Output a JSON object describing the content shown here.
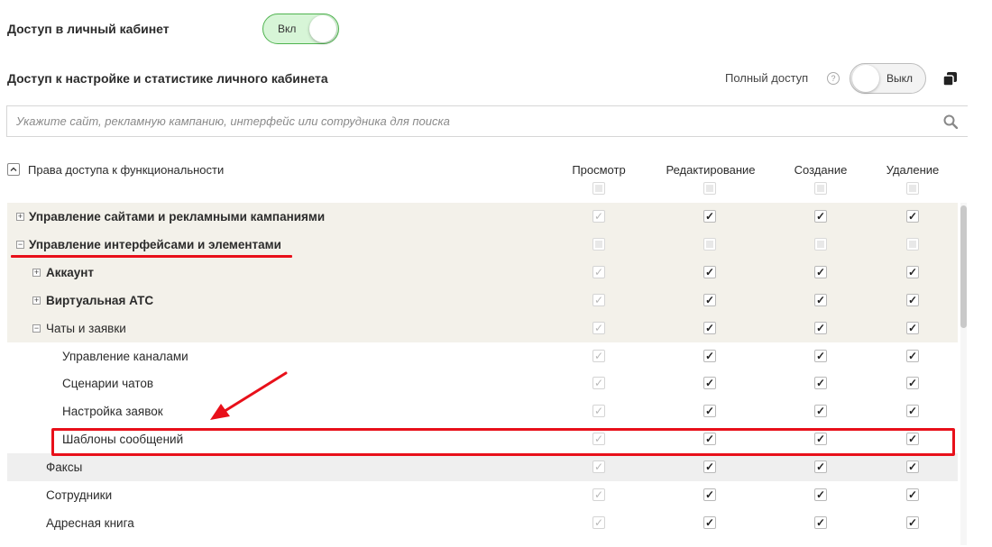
{
  "access": {
    "label": "Доступ в личный кабинет",
    "toggle_label": "Вкл",
    "toggle_on": true
  },
  "settings_access": {
    "label": "Доступ к настройке и статистике личного кабинета",
    "full_access_label": "Полный доступ",
    "full_access_help_icon": "question-circle-icon",
    "full_access_toggle_label": "Выкл",
    "full_access_on": false,
    "copy_icon": "copy-icon"
  },
  "search": {
    "placeholder": "Укажите сайт, рекламную кампанию, интерфейс или сотрудника для поиска",
    "icon": "search-icon"
  },
  "table": {
    "title": "Права доступа к функциональности",
    "collapse_icon": "chevron-up-icon",
    "columns": [
      "Просмотр",
      "Редактирование",
      "Создание",
      "Удаление"
    ],
    "rows": [
      {
        "label": "Управление сайтами и рекламными кампаниями",
        "expander": "+",
        "level": 0,
        "bold": true,
        "bg": "beige",
        "states": [
          "dim",
          "check",
          "check",
          "check"
        ]
      },
      {
        "label": "Управление интерфейсами и элементами",
        "expander": "−",
        "level": 0,
        "bold": true,
        "bg": "beige",
        "states": [
          "filled",
          "filled",
          "filled",
          "filled"
        ]
      },
      {
        "label": "Аккаунт",
        "expander": "+",
        "level": 1,
        "bold": true,
        "bg": "beige",
        "states": [
          "dim",
          "check",
          "check",
          "check"
        ]
      },
      {
        "label": "Виртуальная АТС",
        "expander": "+",
        "level": 1,
        "bold": true,
        "bg": "beige",
        "states": [
          "dim",
          "check",
          "check",
          "check"
        ]
      },
      {
        "label": "Чаты и заявки",
        "expander": "−",
        "level": 1,
        "bold": false,
        "bg": "beige",
        "states": [
          "dim",
          "check",
          "check",
          "check"
        ]
      },
      {
        "label": "Управление каналами",
        "expander": "",
        "level": 2,
        "bold": false,
        "bg": "white",
        "states": [
          "dim",
          "check",
          "check",
          "check"
        ]
      },
      {
        "label": "Сценарии чатов",
        "expander": "",
        "level": 2,
        "bold": false,
        "bg": "white",
        "states": [
          "dim",
          "check",
          "check",
          "check"
        ]
      },
      {
        "label": "Настройка заявок",
        "expander": "",
        "level": 2,
        "bold": false,
        "bg": "white",
        "states": [
          "dim",
          "check",
          "check",
          "check"
        ]
      },
      {
        "label": "Шаблоны сообщений",
        "expander": "",
        "level": 2,
        "bold": false,
        "bg": "white",
        "states": [
          "dim",
          "check",
          "check",
          "check"
        ]
      },
      {
        "label": "Факсы",
        "expander": "",
        "level": 1,
        "bold": false,
        "bg": "grey",
        "states": [
          "dim",
          "check",
          "check",
          "check"
        ]
      },
      {
        "label": "Сотрудники",
        "expander": "",
        "level": 1,
        "bold": false,
        "bg": "white",
        "states": [
          "dim",
          "check",
          "check",
          "check"
        ]
      },
      {
        "label": "Адресная книга",
        "expander": "",
        "level": 1,
        "bold": false,
        "bg": "white",
        "states": [
          "dim",
          "check",
          "check",
          "check"
        ]
      }
    ]
  },
  "annotation": {
    "highlight_color": "#e8101a"
  }
}
